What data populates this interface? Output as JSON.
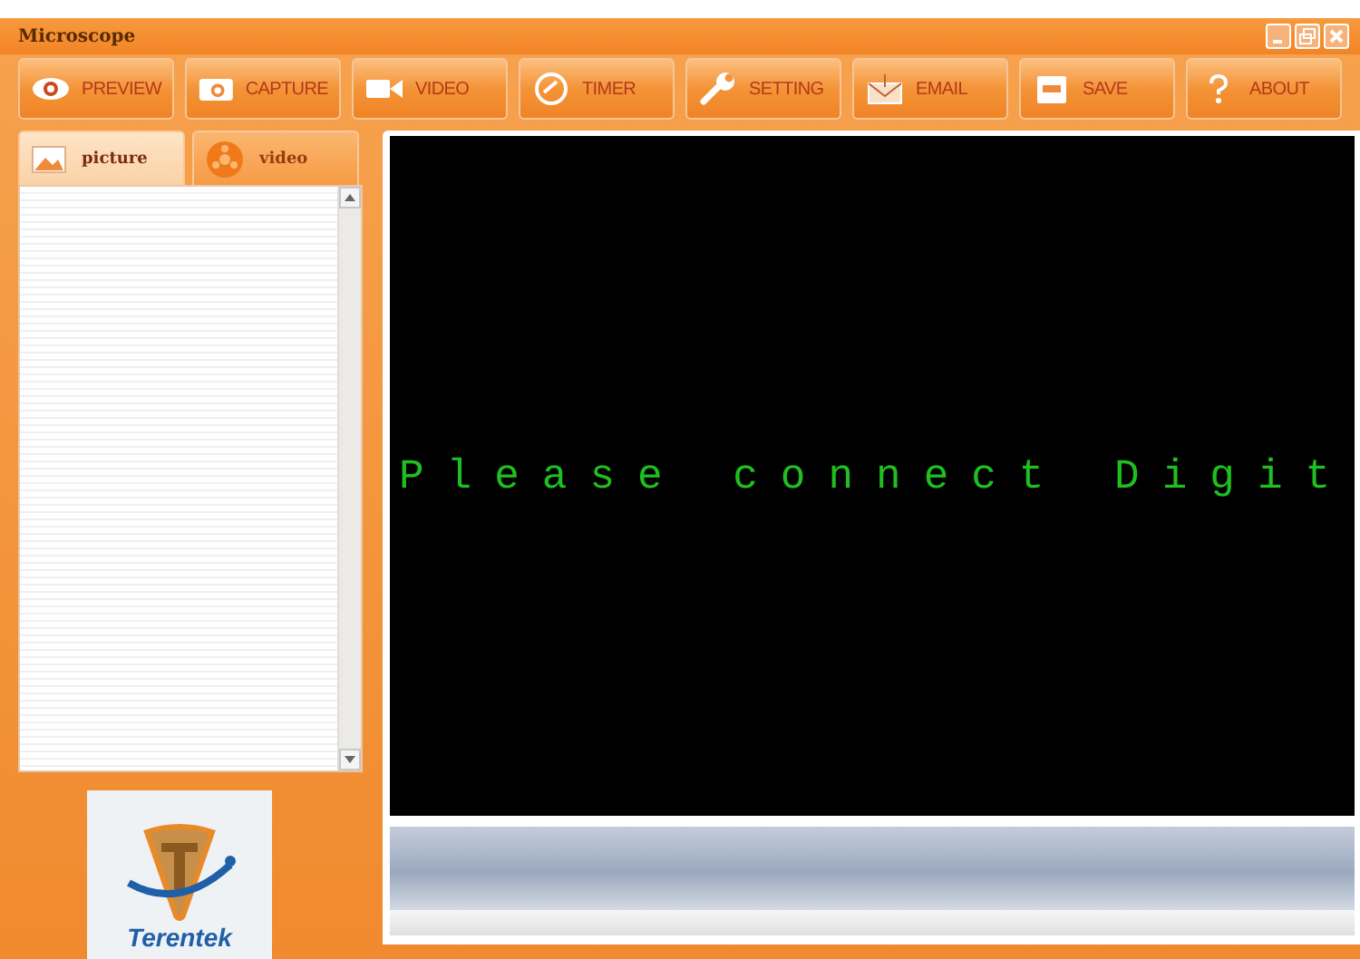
{
  "window": {
    "title": "Microscope"
  },
  "toolbar": [
    {
      "label": "PREVIEW",
      "kind": "eye"
    },
    {
      "label": "CAPTURE",
      "kind": "camera"
    },
    {
      "label": "VIDEO",
      "kind": "video"
    },
    {
      "label": "TIMER",
      "kind": "timer"
    },
    {
      "label": "SETTING",
      "kind": "wrench"
    },
    {
      "label": "EMAIL",
      "kind": "mail"
    },
    {
      "label": "SAVE",
      "kind": "save"
    },
    {
      "label": "ABOUT",
      "kind": "help"
    }
  ],
  "tabs": [
    {
      "label": "picture",
      "kind": "picture",
      "selected": true
    },
    {
      "label": "video",
      "kind": "film",
      "selected": false
    }
  ],
  "logo": {
    "text": "Terentek"
  },
  "preview": {
    "message": "Please connect Digit"
  }
}
